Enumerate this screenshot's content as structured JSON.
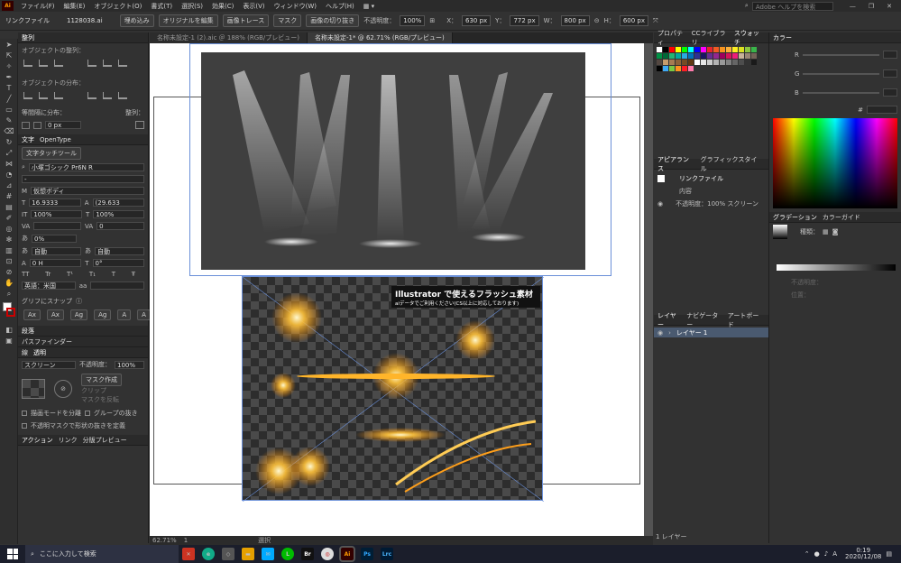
{
  "menu": {
    "items": [
      "ファイル(F)",
      "編集(E)",
      "オブジェクト(O)",
      "書式(T)",
      "選択(S)",
      "効果(C)",
      "表示(V)",
      "ウィンドウ(W)",
      "ヘルプ(H)"
    ],
    "app_logo": "Ai",
    "search_placeholder": "Adobe ヘルプを検索"
  },
  "control": {
    "link_label": "リンクファイル",
    "file_name": "1128038.ai",
    "embed": "埋め込み",
    "edit_original": "オリジナルを編集",
    "image_trace": "画像トレース",
    "mask": "マスク",
    "crop": "画像の切り抜き",
    "opacity_label": "不透明度：",
    "opacity": "100%",
    "x_label": "X：",
    "x": "630 px",
    "y_label": "Y：",
    "y": "772 px",
    "w_label": "W：",
    "w": "800 px",
    "h_label": "H：",
    "h": "600 px"
  },
  "doc_tabs": [
    {
      "label": "名称未設定-1 (2).aic ＠ 188% (RGB/プレビュー)"
    },
    {
      "label": "名称未設定-1* @ 62.71% (RGB/プレビュー)"
    }
  ],
  "align_panel": {
    "title": "整列",
    "obj_align": "オブジェクトの整列：",
    "obj_dist": "オブジェクトの分布：",
    "spacing": "等間隔に分布：",
    "align_to": "整列：",
    "spacing_value": "0 px"
  },
  "char_panel": {
    "tab1": "文字",
    "tab2": "OpenType",
    "touch": "文字タッチツール",
    "font": "小塚ゴシック Pr6N R",
    "style": "-",
    "font2": "仮想ボディ",
    "size": "16.9333",
    "leading": "(29.633",
    "vscale": "100%",
    "hscale": "100%",
    "tracking": "0",
    "kern": "",
    "pct": "0%",
    "auto1": "自動",
    "auto2": "自動",
    "baseline": "0 H",
    "rot": "0°",
    "lang": "英語：米国"
  },
  "snap_panel": {
    "title": "グリフにスナップ"
  },
  "para_panel": {
    "title": "段落",
    "sub": "パスファインダー"
  },
  "trans_panel": {
    "tab1": "線",
    "tab2": "透明",
    "mode": "スクリーン",
    "opacity_label": "不透明度：",
    "opacity": "100%",
    "make_mask": "マスク作成",
    "clip": "クリップ",
    "invert": "マスクを反転",
    "isolate": "描画モードを分離",
    "knockout": "グループの抜き",
    "opacity_mask": "不透明マスクで形状の抜きを定義"
  },
  "bottom_tabs": [
    "アクション",
    "リンク",
    "分版プレビュー"
  ],
  "flash_text": {
    "title": "Illustrator で使えるフラッシュ素材",
    "sub": "aiデータでご利用ください(CS以上に対応しております)"
  },
  "status": {
    "zoom": "62.71%",
    "page": "1",
    "mode": "選択"
  },
  "swatch_tabs": [
    "プロパティ",
    "CCライブラリ",
    "スウォッチ"
  ],
  "appearance": {
    "tab1": "アピアランス",
    "tab2": "グラフィックスタイル",
    "item": "リンクファイル",
    "content": "内容",
    "opacity": "不透明度：100% スクリーン"
  },
  "layers": {
    "tab1": "レイヤー",
    "tab2": "ナビゲーター",
    "tab3": "アートボード",
    "layer": "レイヤー 1",
    "count": "1 レイヤー"
  },
  "color": {
    "title": "カラー",
    "r": "R",
    "g": "G",
    "b": "B",
    "hash": "#"
  },
  "gradient": {
    "tab1": "グラデーション",
    "tab2": "カラーガイド",
    "kind": "種類：",
    "opacity": "不透明度：",
    "position": "位置："
  },
  "taskbar": {
    "search": "ここに入力して検索",
    "time": "0:19",
    "date": "2020/12/08",
    "ime": "A"
  },
  "swatch_colors": [
    "#ffffff",
    "#000000",
    "#ff0000",
    "#ffff00",
    "#00ff00",
    "#00ffff",
    "#0000ff",
    "#ff00ff",
    "#e8262a",
    "#f15a24",
    "#f7931e",
    "#fbb03b",
    "#fcee21",
    "#d9e021",
    "#8cc63f",
    "#39b54a",
    "#009245",
    "#006837",
    "#22b573",
    "#00a99d",
    "#29abe2",
    "#0071bc",
    "#2e3192",
    "#1b1464",
    "#662d91",
    "#93278f",
    "#9e005d",
    "#d4145a",
    "#ed1e79",
    "#c7b299",
    "#998675",
    "#736357",
    "#534741",
    "#c69c6d",
    "#a67c52",
    "#8c6239",
    "#754c24",
    "#603813",
    "#ffffff",
    "#e6e6e6",
    "#cccccc",
    "#b3b3b3",
    "#999999",
    "#808080",
    "#666666",
    "#4d4d4d",
    "#333333",
    "#1a1a1a",
    "#000000",
    "#3fa9f5",
    "#7ac943",
    "#ff931e",
    "#ff1d25",
    "#ff7bac"
  ]
}
